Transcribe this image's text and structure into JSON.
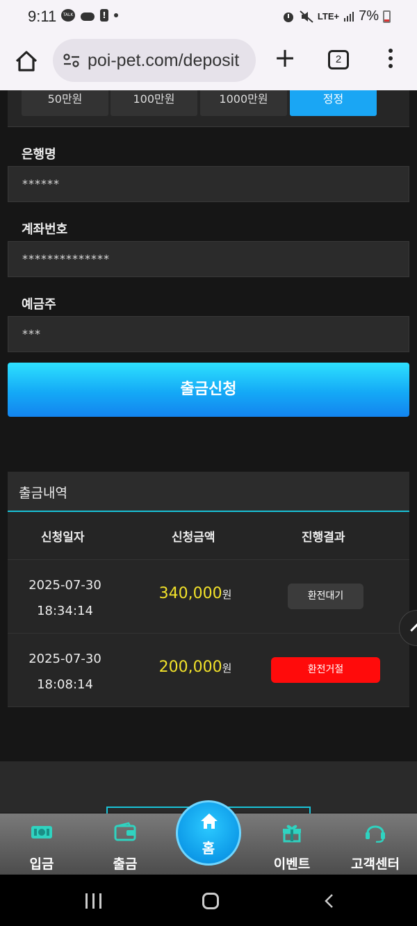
{
  "status_bar": {
    "time": "9:11",
    "talk_label": "TALK",
    "signal": "LTE+",
    "battery": "7%"
  },
  "browser": {
    "url": "poi-pet.com/deposit",
    "tab_count": "2",
    "plus": "+"
  },
  "amounts": [
    "50만원",
    "100만원",
    "1000만원",
    "정정"
  ],
  "form": {
    "bank_label": "은행명",
    "bank_value": "******",
    "account_label": "계좌번호",
    "account_value": "**************",
    "holder_label": "예금주",
    "holder_value": "***",
    "submit_label": "출금신청"
  },
  "history": {
    "title": "출금내역",
    "headers": [
      "신청일자",
      "신청금액",
      "진행결과"
    ],
    "rows": [
      {
        "date": "2025-07-30",
        "time": "18:34:14",
        "amount": "340,000",
        "unit": "원",
        "status": "환전대기"
      },
      {
        "date": "2025-07-30",
        "time": "18:08:14",
        "amount": "200,000",
        "unit": "원",
        "status": "환전거절"
      }
    ]
  },
  "nav": {
    "deposit": "입금",
    "withdraw": "출금",
    "home": "홈",
    "event": "이벤트",
    "support": "고객센터"
  },
  "colors": {
    "accent": "#19c3d8",
    "amount": "#f2e22a",
    "rejected": "#ff0b0b",
    "button": "#14a9f6"
  }
}
